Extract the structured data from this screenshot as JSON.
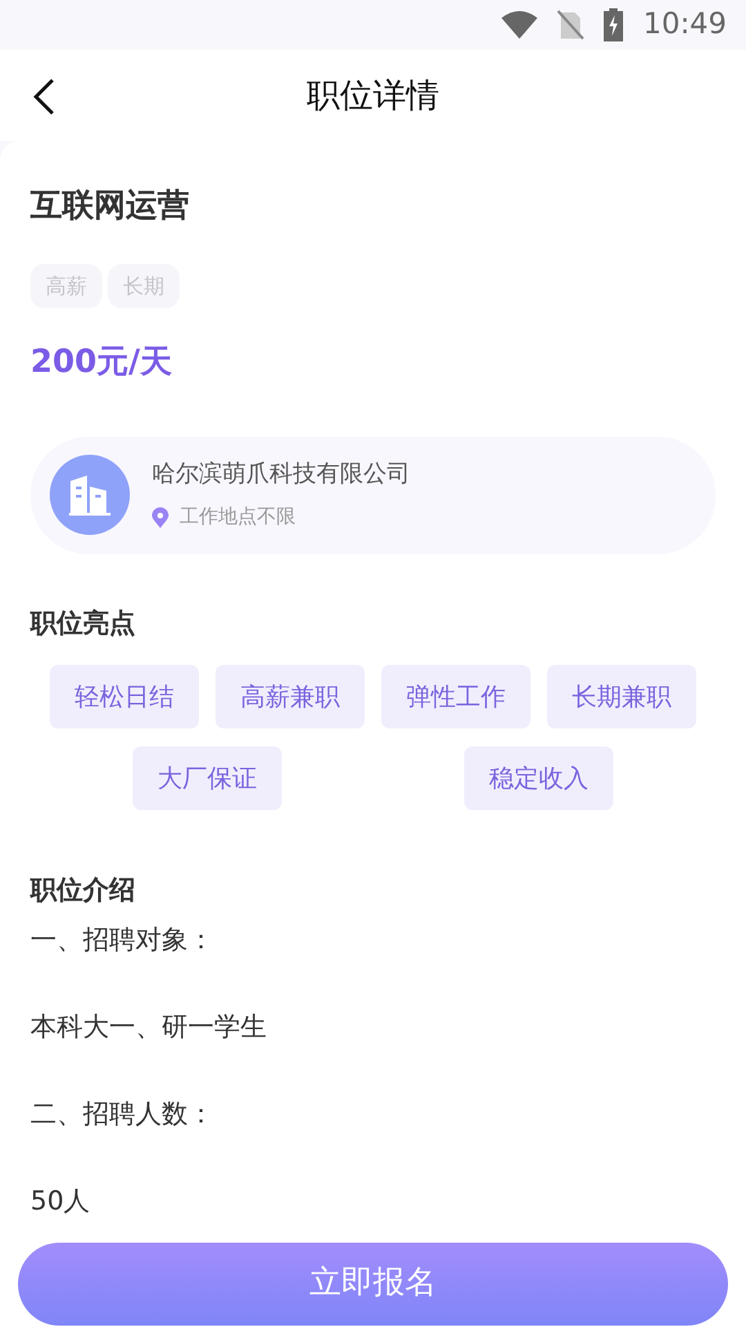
{
  "status_bar": {
    "time": "10:49"
  },
  "header": {
    "title": "职位详情"
  },
  "job": {
    "title": "互联网运营",
    "tags": [
      "高薪",
      "长期"
    ],
    "pay": "200元/天"
  },
  "company": {
    "name": "哈尔滨萌爪科技有限公司",
    "location": "工作地点不限"
  },
  "highlights": {
    "heading": "职位亮点",
    "chips": [
      "轻松日结",
      "高薪兼职",
      "弹性工作",
      "长期兼职",
      "大厂保证",
      "稳定收入"
    ]
  },
  "intro": {
    "heading": "职位介绍",
    "lines": [
      "一、招聘对象：",
      "本科大一、研一学生",
      "二、招聘人数：",
      "50人"
    ]
  },
  "apply_button": {
    "label": "立即报名"
  }
}
